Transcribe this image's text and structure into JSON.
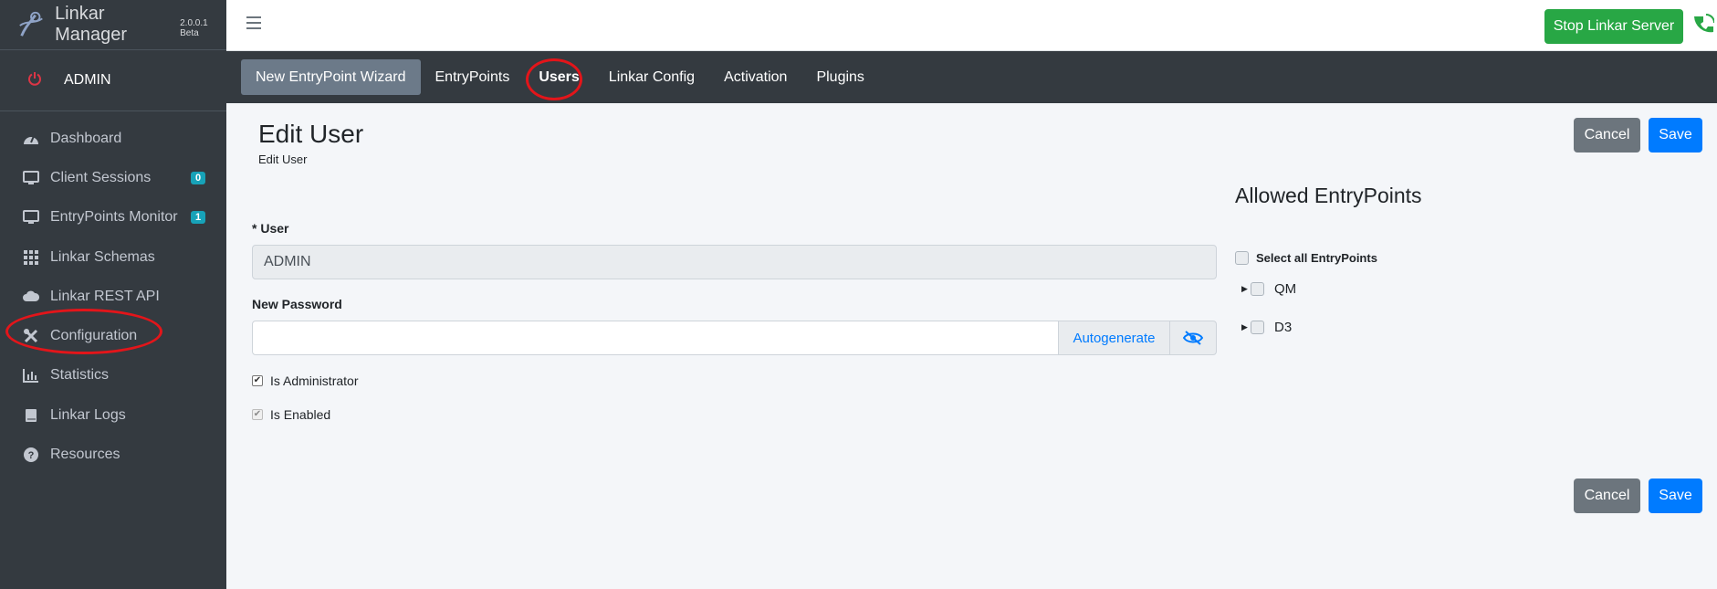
{
  "brand": {
    "title": "Linkar Manager",
    "version": "2.0.0.1 Beta"
  },
  "user_panel": {
    "name": "ADMIN"
  },
  "sidebar": {
    "items": [
      {
        "label": "Dashboard",
        "icon": "dashboard-icon"
      },
      {
        "label": "Client Sessions",
        "icon": "monitor-icon",
        "badge": "0"
      },
      {
        "label": "EntryPoints Monitor",
        "icon": "monitor-icon",
        "badge": "1"
      },
      {
        "label": "Linkar Schemas",
        "icon": "grid-icon"
      },
      {
        "label": "Linkar REST API",
        "icon": "cloud-icon"
      },
      {
        "label": "Configuration",
        "icon": "tools-icon"
      },
      {
        "label": "Statistics",
        "icon": "bar-chart-icon"
      },
      {
        "label": "Linkar Logs",
        "icon": "book-icon"
      },
      {
        "label": "Resources",
        "icon": "question-circle-icon"
      }
    ]
  },
  "topbar": {
    "stop_label": "Stop Linkar Server"
  },
  "tabs": [
    {
      "label": "New EntryPoint Wizard"
    },
    {
      "label": "EntryPoints"
    },
    {
      "label": "Users"
    },
    {
      "label": "Linkar Config"
    },
    {
      "label": "Activation"
    },
    {
      "label": "Plugins"
    }
  ],
  "page": {
    "title": "Edit User",
    "subtitle": "Edit User"
  },
  "buttons": {
    "cancel": "Cancel",
    "save": "Save"
  },
  "form": {
    "user_label": "* User",
    "user_value": "ADMIN",
    "password_label": "New Password",
    "password_value": "",
    "autogenerate_label": "Autogenerate",
    "is_admin_label": "Is Administrator",
    "is_admin_checked": true,
    "is_enabled_label": "Is Enabled",
    "is_enabled_checked": true
  },
  "allowed": {
    "title": "Allowed EntryPoints",
    "select_all_label": "Select all EntryPoints",
    "entrypoints": [
      {
        "label": "QM"
      },
      {
        "label": "D3"
      }
    ]
  },
  "colors": {
    "sidebar_bg": "#343a40",
    "stop_button": "#28a745",
    "save_button": "#007bff",
    "cancel_button": "#6c757d",
    "highlight_circle": "#e3151a"
  }
}
